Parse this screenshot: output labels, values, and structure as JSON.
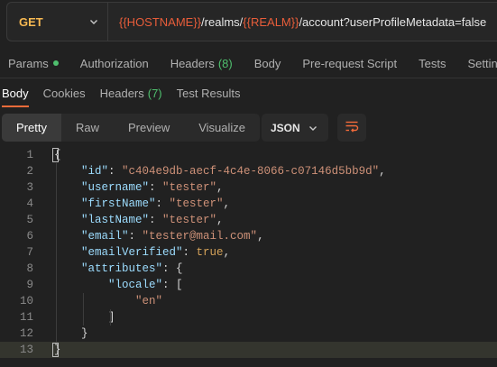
{
  "request": {
    "method": "GET",
    "url_parts": [
      {
        "text": "{{HOSTNAME}}",
        "kind": "var"
      },
      {
        "text": "/realms/",
        "kind": "plain"
      },
      {
        "text": "{{REALM}}",
        "kind": "var"
      },
      {
        "text": "/account?userProfileMetadata=false",
        "kind": "plain"
      }
    ]
  },
  "request_tabs": [
    {
      "label": "Params",
      "indicator": "dot"
    },
    {
      "label": "Authorization"
    },
    {
      "label": "Headers",
      "count": "(8)"
    },
    {
      "label": "Body"
    },
    {
      "label": "Pre-request Script"
    },
    {
      "label": "Tests"
    },
    {
      "label": "Settings"
    }
  ],
  "response_tabs": [
    {
      "label": "Body",
      "active": true
    },
    {
      "label": "Cookies"
    },
    {
      "label": "Headers",
      "count": "(7)"
    },
    {
      "label": "Test Results"
    }
  ],
  "view_modes": [
    "Pretty",
    "Raw",
    "Preview",
    "Visualize"
  ],
  "active_view_mode": "Pretty",
  "format_select": "JSON",
  "body_lines": [
    {
      "n": "1",
      "indent": 0,
      "tokens": [
        {
          "t": "{",
          "c": "p"
        }
      ]
    },
    {
      "n": "2",
      "indent": 1,
      "tokens": [
        {
          "t": "\"id\"",
          "c": "key"
        },
        {
          "t": ": ",
          "c": "p"
        },
        {
          "t": "\"c404e9db-aecf-4c4e-8066-c07146d5bb9d\"",
          "c": "str"
        },
        {
          "t": ",",
          "c": "p"
        }
      ]
    },
    {
      "n": "3",
      "indent": 1,
      "tokens": [
        {
          "t": "\"username\"",
          "c": "key"
        },
        {
          "t": ": ",
          "c": "p"
        },
        {
          "t": "\"tester\"",
          "c": "str"
        },
        {
          "t": ",",
          "c": "p"
        }
      ]
    },
    {
      "n": "4",
      "indent": 1,
      "tokens": [
        {
          "t": "\"firstName\"",
          "c": "key"
        },
        {
          "t": ": ",
          "c": "p"
        },
        {
          "t": "\"tester\"",
          "c": "str"
        },
        {
          "t": ",",
          "c": "p"
        }
      ]
    },
    {
      "n": "5",
      "indent": 1,
      "tokens": [
        {
          "t": "\"lastName\"",
          "c": "key"
        },
        {
          "t": ": ",
          "c": "p"
        },
        {
          "t": "\"tester\"",
          "c": "str"
        },
        {
          "t": ",",
          "c": "p"
        }
      ]
    },
    {
      "n": "6",
      "indent": 1,
      "tokens": [
        {
          "t": "\"email\"",
          "c": "key"
        },
        {
          "t": ": ",
          "c": "p"
        },
        {
          "t": "\"tester@mail.com\"",
          "c": "str"
        },
        {
          "t": ",",
          "c": "p"
        }
      ]
    },
    {
      "n": "7",
      "indent": 1,
      "tokens": [
        {
          "t": "\"emailVerified\"",
          "c": "key"
        },
        {
          "t": ": ",
          "c": "p"
        },
        {
          "t": "true",
          "c": "bool"
        },
        {
          "t": ",",
          "c": "p"
        }
      ]
    },
    {
      "n": "8",
      "indent": 1,
      "tokens": [
        {
          "t": "\"attributes\"",
          "c": "key"
        },
        {
          "t": ": {",
          "c": "p"
        }
      ]
    },
    {
      "n": "9",
      "indent": 2,
      "tokens": [
        {
          "t": "\"locale\"",
          "c": "key"
        },
        {
          "t": ": [",
          "c": "p"
        }
      ]
    },
    {
      "n": "10",
      "indent": 3,
      "tokens": [
        {
          "t": "\"en\"",
          "c": "str"
        }
      ]
    },
    {
      "n": "11",
      "indent": 2,
      "tokens": [
        {
          "t": "]",
          "c": "p"
        }
      ]
    },
    {
      "n": "12",
      "indent": 1,
      "tokens": [
        {
          "t": "}",
          "c": "p"
        }
      ]
    },
    {
      "n": "13",
      "indent": 0,
      "tokens": [
        {
          "t": "}",
          "c": "p"
        }
      ],
      "highlighted": true
    }
  ],
  "colors": {
    "method": "#f8b952",
    "url_variable": "#e85d3a",
    "active_tab_underline": "#f26b3a",
    "indicator": "#4fbf6e",
    "json_key": "#9cdcfe",
    "json_string": "#ce9178",
    "json_bool": "#d4a259"
  },
  "icons": {
    "method_dropdown": "chevron-down-icon",
    "format_dropdown": "chevron-down-icon",
    "wrap": "wrap-lines-icon"
  }
}
